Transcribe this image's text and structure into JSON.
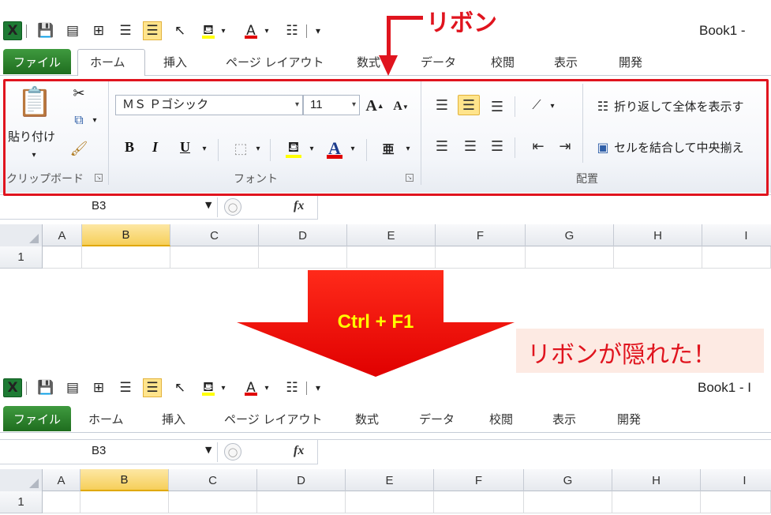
{
  "quick_access": {
    "icons": [
      "excel-logo",
      "save-icon",
      "format-icon",
      "borders-icon",
      "align-left-icon",
      "align-center-icon",
      "pointer-icon",
      "fill-color-icon",
      "font-color-icon",
      "wrap-icon",
      "customize-icon"
    ],
    "excel_glyph": "X",
    "book_title_top": "Book1  -",
    "book_title_bottom": "Book1  -  I"
  },
  "tabs": [
    "ファイル",
    "ホーム",
    "挿入",
    "ページ レイアウト",
    "数式",
    "データ",
    "校閲",
    "表示",
    "開発"
  ],
  "ribbon": {
    "clipboard": {
      "paste_label": "貼り付け",
      "group_label": "クリップボード"
    },
    "font": {
      "font_name": "ＭＳ Ｐゴシック",
      "font_size": "11",
      "grow_label": "A",
      "shrink_label": "A",
      "bold": "B",
      "italic": "I",
      "underline": "U",
      "phonetic": "亜",
      "font_color_glyph": "A",
      "group_label": "フォント"
    },
    "alignment": {
      "wrap_text": "折り返して全体を表示す",
      "merge_center": "セルを結合して中央揃え",
      "group_label": "配置"
    }
  },
  "formula_bar": {
    "name_box": "B3",
    "fx": "fx"
  },
  "grid": {
    "columns": [
      "A",
      "B",
      "C",
      "D",
      "E",
      "F",
      "G",
      "H",
      "I"
    ],
    "selected_column": "B",
    "rows": [
      "1"
    ]
  },
  "annotations": {
    "ribbon_label": "リボン",
    "shortcut": "Ctrl + F1",
    "result": "リボンが隠れた！"
  },
  "colors": {
    "annotation_red": "#e0141e",
    "shortcut_yellow": "#ffff00",
    "file_tab_green": "#2e8b2e",
    "selected_header": "#f6cf5a"
  }
}
